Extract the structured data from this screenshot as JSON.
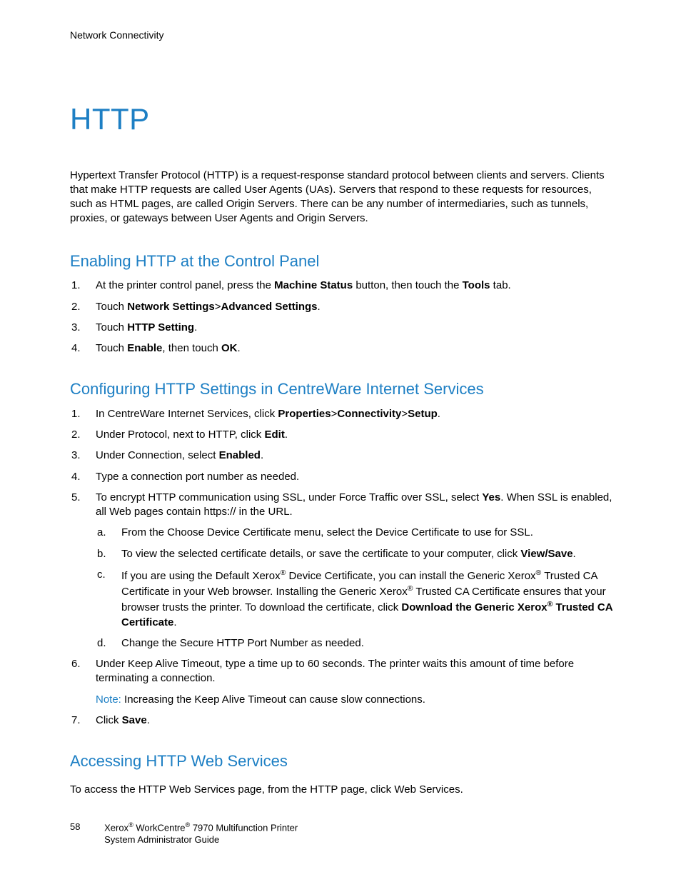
{
  "header": {
    "running": "Network Connectivity"
  },
  "title": "HTTP",
  "intro": "Hypertext Transfer Protocol (HTTP) is a request-response standard protocol between clients and servers. Clients that make HTTP requests are called User Agents (UAs). Servers that respond to these requests for resources, such as HTML pages, are called Origin Servers. There can be any number of intermediaries, such as tunnels, proxies, or gateways between User Agents and Origin Servers.",
  "section1": {
    "heading": "Enabling HTTP at the Control Panel",
    "items": {
      "n1": "1.",
      "t1a": "At the printer control panel, press the ",
      "t1b": "Machine Status",
      "t1c": " button, then touch the ",
      "t1d": "Tools",
      "t1e": " tab.",
      "n2": "2.",
      "t2a": "Touch ",
      "t2b": "Network Settings",
      "t2c": ">",
      "t2d": "Advanced Settings",
      "t2e": ".",
      "n3": "3.",
      "t3a": "Touch ",
      "t3b": "HTTP Setting",
      "t3c": ".",
      "n4": "4.",
      "t4a": "Touch ",
      "t4b": "Enable",
      "t4c": ", then touch ",
      "t4d": "OK",
      "t4e": "."
    }
  },
  "section2": {
    "heading": "Configuring HTTP Settings in CentreWare Internet Services",
    "items": {
      "n1": "1.",
      "t1a": "In CentreWare Internet Services, click ",
      "t1b": "Properties",
      "t1c": ">",
      "t1d": "Connectivity",
      "t1e": ">",
      "t1f": "Setup",
      "t1g": ".",
      "n2": "2.",
      "t2a": "Under Protocol, next to HTTP, click ",
      "t2b": "Edit",
      "t2c": ".",
      "n3": "3.",
      "t3a": "Under Connection, select ",
      "t3b": "Enabled",
      "t3c": ".",
      "n4": "4.",
      "t4": "Type a connection port number as needed.",
      "n5": "5.",
      "t5a": "To encrypt HTTP communication using SSL, under Force Traffic over SSL, select ",
      "t5b": "Yes",
      "t5c": ". When SSL is enabled, all Web pages contain https:// in the URL.",
      "sa_l": "a.",
      "sa_t": "From the Choose Device Certificate menu, select the Device Certificate to use for SSL.",
      "sb_l": "b.",
      "sb_t1": "To view the selected certificate details, or save the certificate to your computer, click ",
      "sb_t2": "View/Save",
      "sb_t3": ".",
      "sc_l": "c.",
      "sc_t1": "If you are using the Default Xerox",
      "sc_sup": "®",
      "sc_t2": " Device Certificate, you can install the Generic Xerox",
      "sc_t3": " Trusted CA Certificate in your Web browser. Installing the Generic Xerox",
      "sc_t4": " Trusted CA Certificate ensures that your browser trusts the printer. To download the certificate, click ",
      "sc_t5": "Download the Generic Xerox",
      "sc_t6": " Trusted CA Certificate",
      "sc_t7": ".",
      "sd_l": "d.",
      "sd_t": "Change the Secure HTTP Port Number as needed.",
      "n6": "6.",
      "t6": "Under Keep Alive Timeout, type a time up to 60 seconds. The printer waits this amount of time before terminating a connection.",
      "note_label": "Note:",
      "note_text": " Increasing the Keep Alive Timeout can cause slow connections.",
      "n7": "7.",
      "t7a": "Click ",
      "t7b": "Save",
      "t7c": "."
    }
  },
  "section3": {
    "heading": "Accessing HTTP Web Services",
    "text": "To access the HTTP Web Services page, from the HTTP page, click Web Services."
  },
  "footer": {
    "page": "58",
    "line1a": "Xerox",
    "line1b": " WorkCentre",
    "line1c": " 7970 Multifunction Printer",
    "line2": "System Administrator Guide",
    "sup": "®"
  }
}
